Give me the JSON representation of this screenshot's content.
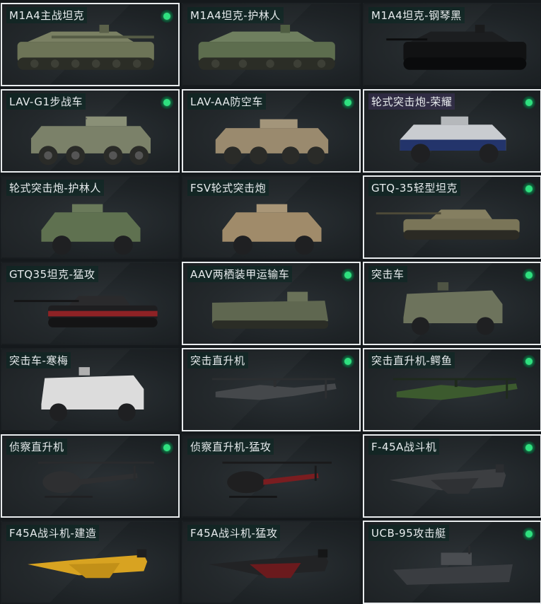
{
  "vehicles": [
    {
      "name": "M1A4主战坦克",
      "owned": true,
      "status_icon": "green-dot-icon"
    },
    {
      "name": "M1A4坦克-护林人",
      "owned": false
    },
    {
      "name": "M1A4坦克-钢琴黑",
      "owned": false
    },
    {
      "name": "LAV-G1步战车",
      "owned": true,
      "status_icon": "green-dot-icon"
    },
    {
      "name": "LAV-AA防空车",
      "owned": true,
      "status_icon": "green-dot-icon"
    },
    {
      "name": "轮式突击炮-荣耀",
      "owned": true,
      "status_icon": "green-dot-icon"
    },
    {
      "name": "轮式突击炮-护林人",
      "owned": false
    },
    {
      "name": "FSV轮式突击炮",
      "owned": false
    },
    {
      "name": "GTQ-35轻型坦克",
      "owned": true,
      "status_icon": "green-dot-icon"
    },
    {
      "name": "GTQ35坦克-猛攻",
      "owned": false
    },
    {
      "name": "AAV两栖装甲运输车",
      "owned": true,
      "status_icon": "green-dot-icon"
    },
    {
      "name": "突击车",
      "owned": true,
      "status_icon": "green-dot-icon"
    },
    {
      "name": "突击车-寒梅",
      "owned": false
    },
    {
      "name": "突击直升机",
      "owned": true,
      "status_icon": "green-dot-icon"
    },
    {
      "name": "突击直升机-鳄鱼",
      "owned": true,
      "status_icon": "green-dot-icon"
    },
    {
      "name": "侦察直升机",
      "owned": true,
      "status_icon": "green-dot-icon"
    },
    {
      "name": "侦察直升机-猛攻",
      "owned": false
    },
    {
      "name": "F-45A战斗机",
      "owned": true,
      "status_icon": "green-dot-icon"
    },
    {
      "name": "F45A战斗机-建造",
      "owned": false
    },
    {
      "name": "F45A战斗机-猛攻",
      "owned": false
    },
    {
      "name": "UCB-95攻击艇",
      "owned": true,
      "status_icon": "green-dot-icon"
    }
  ],
  "colors": {
    "owned_border": "#e9ecee",
    "status_dot": "#2fe07f",
    "background": "#15191c"
  }
}
